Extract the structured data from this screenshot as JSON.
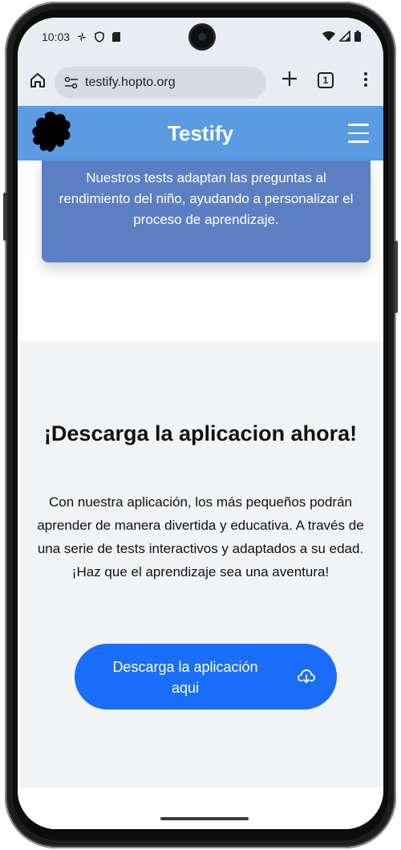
{
  "status_bar": {
    "time": "10:03"
  },
  "browser": {
    "url": "testify.hopto.org",
    "tab_count": "1"
  },
  "site": {
    "title": "Testify"
  },
  "info_card": {
    "text": "Nuestros tests adaptan las preguntas al rendimiento del niño, ayudando a personalizar el proceso de aprendizaje."
  },
  "download": {
    "heading": "¡Descarga la aplicacion ahora!",
    "paragraph": "Con nuestra aplicación, los más pequeños podrán aprender de manera divertida y educativa. A través de una serie de tests interactivos y adaptados a su edad.",
    "tagline": "¡Haz que el aprendizaje sea una aventura!",
    "button_label": "Descarga la aplicación aqui"
  },
  "colors": {
    "header": "#5b9be2",
    "card": "#5c7fc3",
    "button": "#1a6df8",
    "section_bg": "#f2f3f5"
  },
  "icons": {
    "home": "home-icon",
    "site_settings": "site-settings-icon",
    "new_tab": "plus-icon",
    "tabs": "tab-switcher-icon",
    "menu": "more-vert-icon",
    "logo": "puzzle-logo",
    "hamburger": "hamburger-icon",
    "cloud_download": "cloud-download-icon"
  }
}
